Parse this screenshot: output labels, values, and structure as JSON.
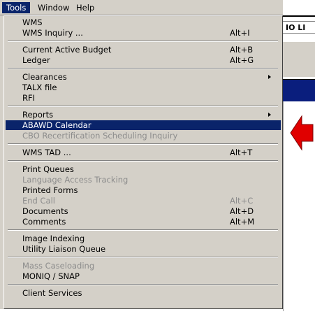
{
  "menubar": {
    "items": [
      {
        "label": "Tools",
        "active": true
      },
      {
        "label": "Window",
        "active": false
      },
      {
        "label": "Help",
        "active": false
      }
    ]
  },
  "background": {
    "title_fragment": "IO LI"
  },
  "menu": {
    "groups": [
      [
        {
          "label": "WMS",
          "shortcut": "",
          "submenu": false,
          "disabled": false
        },
        {
          "label": "WMS Inquiry ...",
          "shortcut": "Alt+I",
          "submenu": false,
          "disabled": false
        }
      ],
      [
        {
          "label": "Current Active Budget",
          "shortcut": "Alt+B",
          "submenu": false,
          "disabled": false
        },
        {
          "label": "Ledger",
          "shortcut": "Alt+G",
          "submenu": false,
          "disabled": false
        }
      ],
      [
        {
          "label": "Clearances",
          "shortcut": "",
          "submenu": true,
          "disabled": false
        },
        {
          "label": "TALX file",
          "shortcut": "",
          "submenu": false,
          "disabled": false
        },
        {
          "label": "RFI",
          "shortcut": "",
          "submenu": false,
          "disabled": false
        }
      ],
      [
        {
          "label": "Reports",
          "shortcut": "",
          "submenu": true,
          "disabled": false
        },
        {
          "label": "ABAWD Calendar",
          "shortcut": "",
          "submenu": false,
          "disabled": false,
          "highlighted": true
        },
        {
          "label": "CBO Recertification Scheduling Inquiry",
          "shortcut": "",
          "submenu": false,
          "disabled": true
        }
      ],
      [
        {
          "label": "WMS TAD ...",
          "shortcut": "Alt+T",
          "submenu": false,
          "disabled": false
        }
      ],
      [
        {
          "label": "Print Queues",
          "shortcut": "",
          "submenu": false,
          "disabled": false
        },
        {
          "label": "Language Access Tracking",
          "shortcut": "",
          "submenu": false,
          "disabled": true
        },
        {
          "label": "Printed Forms",
          "shortcut": "",
          "submenu": false,
          "disabled": false
        },
        {
          "label": "End Call",
          "shortcut": "Alt+C",
          "submenu": false,
          "disabled": true
        },
        {
          "label": "Documents",
          "shortcut": "Alt+D",
          "submenu": false,
          "disabled": false
        },
        {
          "label": "Comments",
          "shortcut": "Alt+M",
          "submenu": false,
          "disabled": false
        }
      ],
      [
        {
          "label": "Image Indexing",
          "shortcut": "",
          "submenu": false,
          "disabled": false
        },
        {
          "label": "Utility Liaison Queue",
          "shortcut": "",
          "submenu": false,
          "disabled": false
        }
      ],
      [
        {
          "label": "Mass Caseloading",
          "shortcut": "",
          "submenu": false,
          "disabled": true
        },
        {
          "label": "MONIQ / SNAP",
          "shortcut": "",
          "submenu": false,
          "disabled": false
        }
      ],
      [
        {
          "label": "Client Services",
          "shortcut": "",
          "submenu": false,
          "disabled": false
        }
      ]
    ]
  },
  "annotation": {
    "arrow_color": "#e00000",
    "points_to": "ABAWD Calendar"
  },
  "colors": {
    "menu_bg": "#d4d0c8",
    "highlight": "#0a246a",
    "disabled_text": "#8c8c8c"
  }
}
